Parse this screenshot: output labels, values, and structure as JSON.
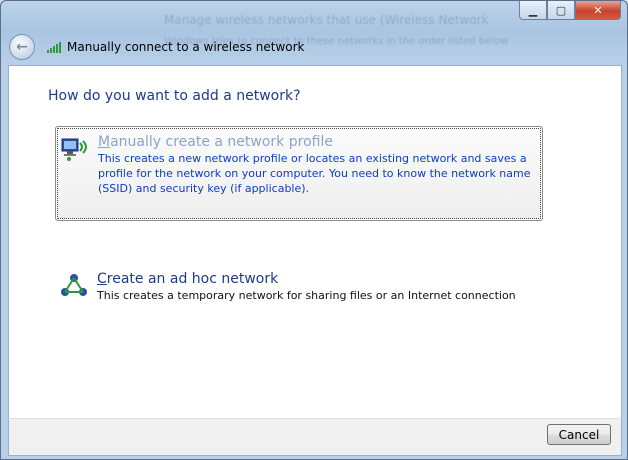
{
  "window": {
    "background_title": "Manage wireless networks that use (Wireless Network",
    "background_subtitle": "Windows tries to connect to these networks in the order listed below"
  },
  "nav": {
    "title": "Manually connect to a wireless network"
  },
  "heading": "How do you want to add a network?",
  "options": [
    {
      "title": "Manually create a network profile",
      "accelerator_index": 0,
      "description": "This creates a new network profile or locates an existing network and saves a profile for the network on your computer. You need to know the network name (SSID) and security key (if applicable).",
      "icon": "network-computer-icon",
      "selected": true
    },
    {
      "title": "Create an ad hoc network",
      "accelerator_index": 0,
      "description": "This creates a temporary network for sharing files or an Internet connection",
      "icon": "ad-hoc-network-icon",
      "selected": false
    }
  ],
  "footer": {
    "cancel_label": "Cancel"
  },
  "colors": {
    "heading": "#1e3a8a",
    "link_description": "#0e3dc2",
    "close_button": "#c7432c"
  }
}
